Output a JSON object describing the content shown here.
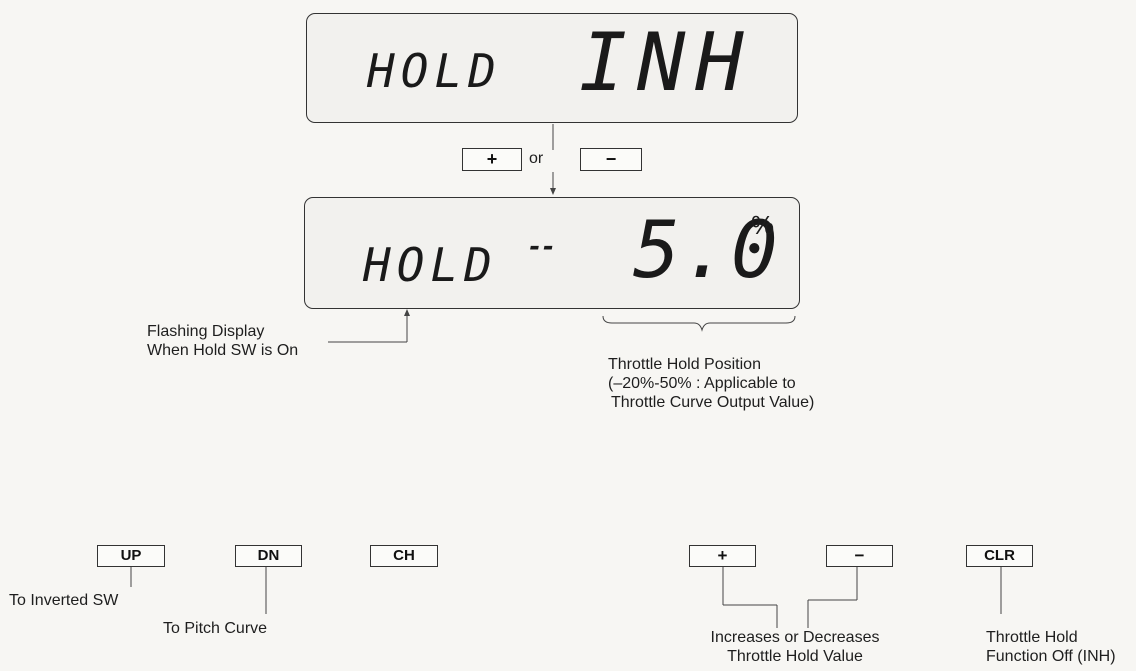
{
  "display_top": {
    "label": "HOLD",
    "value": "INH"
  },
  "connector": {
    "plus_key": "+",
    "or_text": "or",
    "minus_key": "−"
  },
  "display_bottom": {
    "label": "HOLD",
    "indicator": "--",
    "value": "5.0",
    "unit": "%"
  },
  "annotations": {
    "flashing": [
      "Flashing Display",
      "When Hold SW is On"
    ],
    "throttle_hold_position": [
      "Throttle Hold Position",
      "(–20%-50% : Applicable to",
      "Throttle Curve Output Value)"
    ]
  },
  "keys": {
    "up": "UP",
    "dn": "DN",
    "ch": "CH",
    "plus": "+",
    "minus": "−",
    "clr": "CLR"
  },
  "key_labels": {
    "up": "To Inverted SW",
    "dn": "To Pitch Curve",
    "plus_minus": [
      "Increases or Decreases",
      "Throttle Hold Value"
    ],
    "clr": [
      "Throttle Hold",
      "Function Off (INH)"
    ]
  }
}
